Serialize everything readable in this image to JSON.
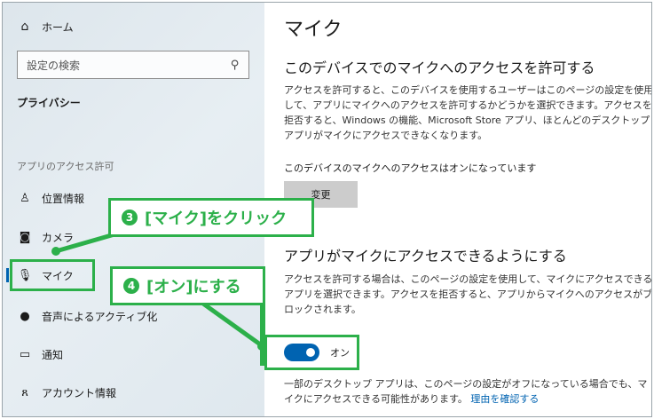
{
  "sidebar": {
    "home": "ホーム",
    "search_placeholder": "設定の検索",
    "section_privacy": "プライバシー",
    "section_apps": "アプリのアクセス許可",
    "items": [
      {
        "label": "位置情報",
        "icon": "location-icon"
      },
      {
        "label": "カメラ",
        "icon": "camera-icon"
      },
      {
        "label": "マイク",
        "icon": "microphone-icon"
      },
      {
        "label": "音声によるアクティブ化",
        "icon": "voice-icon"
      },
      {
        "label": "通知",
        "icon": "notification-icon"
      },
      {
        "label": "アカウント情報",
        "icon": "account-info-icon"
      }
    ]
  },
  "main": {
    "title": "マイク",
    "device_heading": "このデバイスでのマイクへのアクセスを許可する",
    "device_para": "アクセスを許可すると、このデバイスを使用するユーザーはこのページの設定を使用して、アプリにマイクへのアクセスを許可するかどうかを選択できます。アクセスを拒否すると、Windows の機能、Microsoft Store アプリ、ほとんどのデスクトップ アプリがマイクにアクセスできなくなります。",
    "device_status": "このデバイスのマイクへのアクセスはオンになっています",
    "change_button": "変更",
    "apps_heading": "アプリがマイクにアクセスできるようにする",
    "apps_para": "アクセスを許可する場合は、このページの設定を使用して、マイクにアクセスできるアプリを選択できます。アクセスを拒否すると、アプリからマイクへのアクセスがブロックされます。",
    "toggle_label": "オン",
    "toggle_on": true,
    "footer_text": "一部のデスクトップ アプリは、このページの設定がオフになっている場合でも、マイクにアクセスできる可能性があります。",
    "footer_link": "理由を確認する"
  },
  "callouts": {
    "step3_num": "3",
    "step3_text": "[マイク]をクリック",
    "step4_num": "4",
    "step4_text": "[オン]にする"
  },
  "colors": {
    "accent": "#0063b1",
    "annotation": "#2cb04a"
  }
}
